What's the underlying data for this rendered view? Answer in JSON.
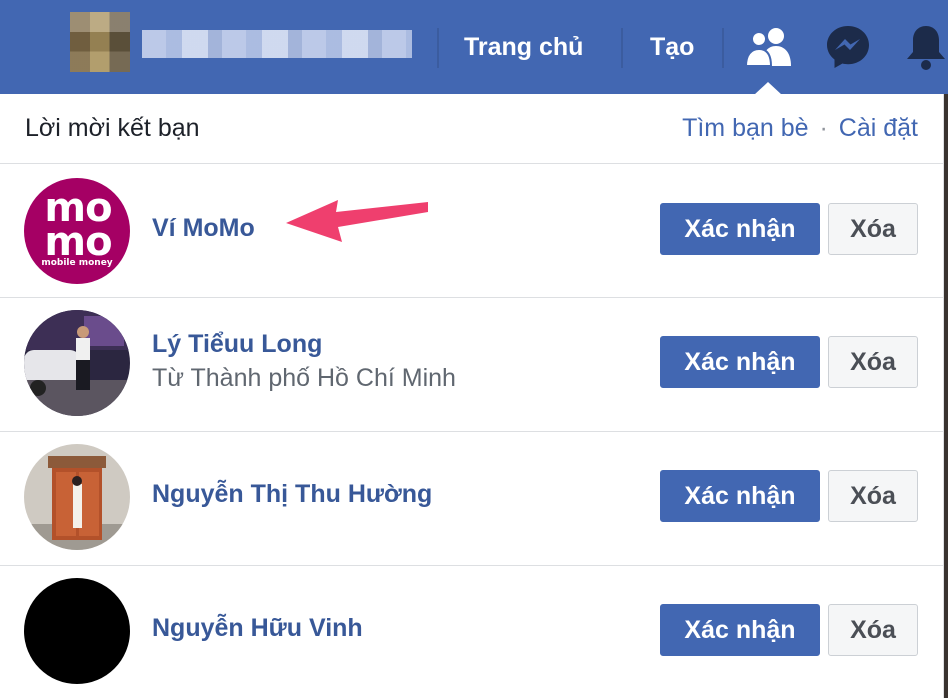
{
  "topbar": {
    "nav": [
      {
        "label": "Trang chủ"
      },
      {
        "label": "Tạo"
      }
    ],
    "colors": {
      "bar": "#4267b2"
    }
  },
  "panel": {
    "title": "Lời mời kết bạn",
    "links": {
      "find_friends": "Tìm bạn bè",
      "separator": "·",
      "settings": "Cài đặt"
    }
  },
  "requests": [
    {
      "name": "Ví MoMo",
      "subtitle": "",
      "confirm_label": "Xác nhận",
      "delete_label": "Xóa",
      "avatar_text": [
        "mo",
        "mo",
        "mobile money"
      ]
    },
    {
      "name": "Lý Tiểuu Long",
      "subtitle": "Từ Thành phố Hồ Chí Minh",
      "confirm_label": "Xác nhận",
      "delete_label": "Xóa"
    },
    {
      "name": "Nguyễn Thị Thu Hường",
      "subtitle": "",
      "confirm_label": "Xác nhận",
      "delete_label": "Xóa"
    },
    {
      "name": "Nguyễn Hữu Vinh",
      "subtitle": "",
      "confirm_label": "Xác nhận",
      "delete_label": "Xóa"
    }
  ],
  "annotation": {
    "arrow_color": "#ef3f6e"
  }
}
